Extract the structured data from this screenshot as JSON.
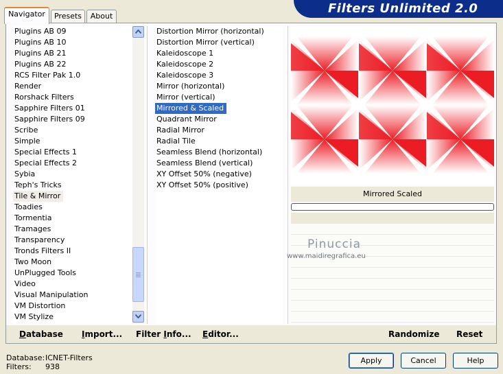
{
  "header": {
    "title": "Filters Unlimited 2.0"
  },
  "tabs": [
    {
      "label": "Navigator",
      "active": true
    },
    {
      "label": "Presets",
      "active": false
    },
    {
      "label": "About",
      "active": false
    }
  ],
  "categories": [
    "Plugins AB 09",
    "Plugins AB 10",
    "Plugins AB 21",
    "Plugins AB 22",
    "RCS Filter Pak 1.0",
    "Render",
    "Rorshack Filters",
    "Sapphire Filters 01",
    "Sapphire Filters 09",
    "Scribe",
    "Simple",
    "Special Effects 1",
    "Special Effects 2",
    "Sybia",
    "Teph's Tricks",
    "Tile & Mirror",
    "Toadies",
    "Tormentia",
    "Tramages",
    "Transparency",
    "Tronds Filters II",
    "Two Moon",
    "UnPlugged Tools",
    "Video",
    "Visual Manipulation",
    "VM Distortion",
    "VM Stylize"
  ],
  "selected_category": "Tile & Mirror",
  "filters": [
    "Distortion Mirror (horizontal)",
    "Distortion Mirror (vertical)",
    "Kaleidoscope 1",
    "Kaleidoscope 2",
    "Kaleidoscope 3",
    "Mirror (horizontal)",
    "Mirror (vertical)",
    "Mirrored & Scaled",
    "Quadrant Mirror",
    "Radial Mirror",
    "Radial Tile",
    "Seamless Blend (horizontal)",
    "Seamless Blend (vertical)",
    "XY Offset 50% (negative)",
    "XY Offset 50% (positive)"
  ],
  "selected_filter": "Mirrored & Scaled",
  "preview": {
    "caption": "Mirrored  Scaled",
    "accent_color": "#ec1c24"
  },
  "watermark": {
    "name": "Pinuccia",
    "url": "www.maidiregrafica.eu"
  },
  "toolbar": {
    "database": {
      "accel": "D",
      "rest": "atabase"
    },
    "import": {
      "accel": "I",
      "rest": "mport..."
    },
    "filter_info": {
      "pre": "Filter ",
      "accel": "I",
      "rest": "nfo..."
    },
    "editor": {
      "accel": "E",
      "rest": "ditor..."
    },
    "randomize": "Randomize",
    "reset": "Reset"
  },
  "status": {
    "database_label": "Database:",
    "database_value": "ICNET-Filters",
    "filters_label": "Filters:",
    "filters_value": "938"
  },
  "buttons": {
    "apply": "Apply",
    "cancel": "Cancel",
    "help": "Help"
  },
  "icons": {
    "scroll_up": "chevron-up-icon",
    "scroll_down": "chevron-down-icon"
  }
}
